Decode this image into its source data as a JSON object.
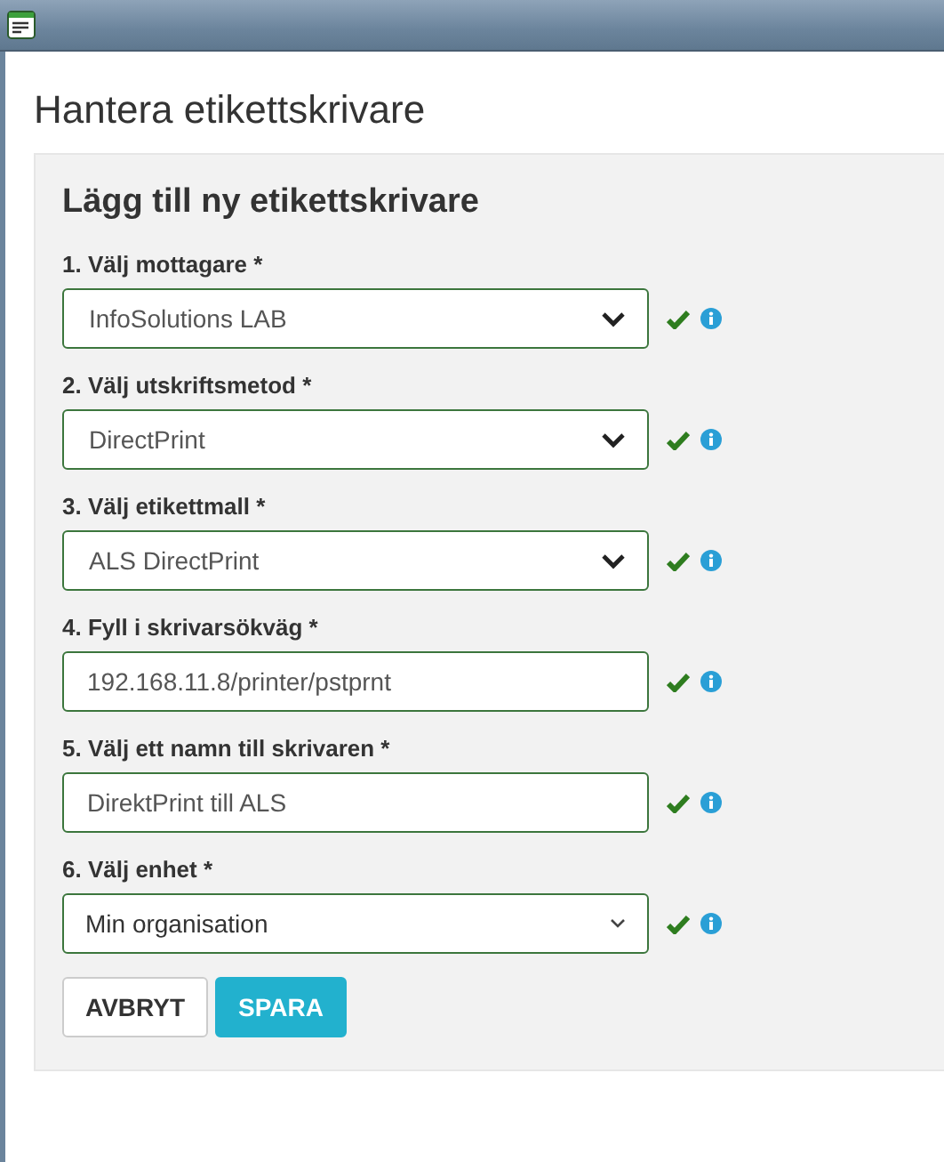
{
  "page_title": "Hantera etikettskrivare",
  "form": {
    "heading": "Lägg till ny etikettskrivare",
    "fields": [
      {
        "label": "1. Välj mottagare *",
        "kind": "select",
        "value": "InfoSolutions LAB",
        "valid": true
      },
      {
        "label": "2. Välj utskriftsmetod *",
        "kind": "select",
        "value": "DirectPrint",
        "valid": true
      },
      {
        "label": "3. Välj etikettmall *",
        "kind": "select",
        "value": "ALS DirectPrint",
        "valid": true
      },
      {
        "label": "4. Fyll i skrivarsökväg *",
        "kind": "input",
        "value": "192.168.11.8/printer/pstprnt",
        "valid": true
      },
      {
        "label": "5. Välj ett namn till skrivaren *",
        "kind": "input",
        "value": "DirektPrint till ALS",
        "valid": true
      },
      {
        "label": "6. Välj enhet *",
        "kind": "native-select",
        "value": "Min organisation",
        "valid": true
      }
    ],
    "buttons": [
      {
        "label": "AVBRYT",
        "kind": "secondary"
      },
      {
        "label": "SPARA",
        "kind": "primary"
      }
    ]
  }
}
